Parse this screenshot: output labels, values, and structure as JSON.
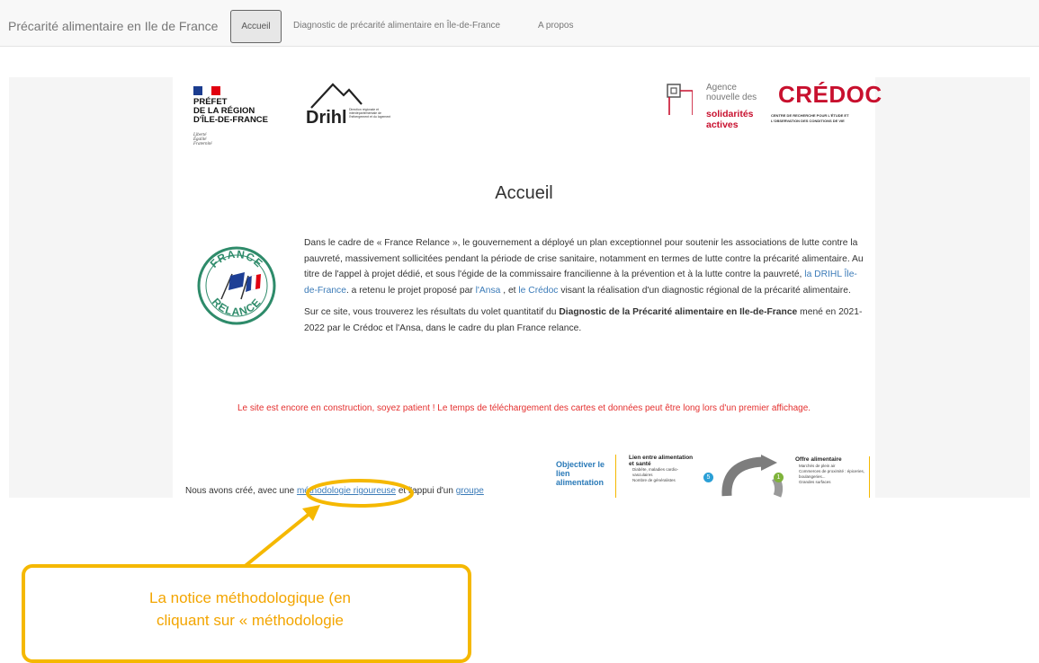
{
  "navbar": {
    "brand": "Précarité alimentaire en Ile de France",
    "items": [
      "Accueil",
      "Diagnostic de précarité alimentaire en Île-de-France",
      "A propos"
    ]
  },
  "logos": {
    "prefet": {
      "line1": "PRÉFET",
      "line2": "DE LA RÉGION",
      "line3": "D'ÎLE-DE-FRANCE",
      "devise1": "Liberté",
      "devise2": "Égalité",
      "devise3": "Fraternité"
    },
    "drihl": {
      "name": "Drihl",
      "sub": "Direction régionale et interdépartementale de l'hébergement et du logement"
    },
    "ansa": {
      "line1": "Agence",
      "line2": "nouvelle des",
      "line3": "solidarités",
      "line4": "actives"
    },
    "credoc": {
      "name": "CRÉDOC",
      "sub1": "CENTRE DE RECHERCHE POUR L'ÉTUDE ET",
      "sub2": "L'OBSERVATION DES CONDITIONS DE VIE"
    },
    "france_relance": {
      "top": "FRANCE",
      "bottom": "RELANCE"
    }
  },
  "main": {
    "title": "Accueil",
    "p1_a": "Dans le cadre de « France Relance », le gouvernement a déployé un plan exceptionnel pour soutenir les associations de lutte contre la pauvreté, massivement sollicitées pendant la période de crise sanitaire, notamment en termes de lutte contre la précarité alimentaire. Au titre de l'appel à projet dédié, et sous l'égide de la commissaire francilienne à la prévention et à la lutte contre la pauvreté, ",
    "p1_link1": "la DRIHL Île-de-France",
    "p1_b": ". a retenu le projet proposé par ",
    "p1_link2": "l'Ansa",
    "p1_c": " , et ",
    "p1_link3": "le Crédoc",
    "p1_d": " visant la réalisation d'un diagnostic régional de la précarité alimentaire.",
    "p2_a": "Sur ce site, vous trouverez les résultats du volet quantitatif du ",
    "p2_bold": "Diagnostic de la Précarité alimentaire en Ile-de-France",
    "p2_b": " mené en 2021-2022 par le Crédoc et l'Ansa, dans le cadre du plan France relance.",
    "warning": "Le site est encore en construction, soyez patient ! Le temps de téléchargement des cartes et données peut être long lors d'un premier affichage.",
    "bottom_a": "Nous avons créé, avec une ",
    "bottom_link1": "méthodologie rigoureuse",
    "bottom_b": " et l'appui d'un ",
    "bottom_link2": "groupe"
  },
  "diagram": {
    "left_label": "Objectiver le lien alimentation",
    "col1_title": "Lien entre alimentation et santé",
    "col1_item1": "Diabète, maladies cardio-vasculaires",
    "col1_item2": "Nombre de généralistes",
    "col2_title": "Offre alimentaire",
    "col2_item1": "Marchés de plein air",
    "col2_item2": "Commerces de proximité : épiceries, boulangeries...",
    "col2_item3": "Grandes surfaces",
    "badge_left": "5",
    "badge_right": "1"
  },
  "callout": {
    "line1": "La notice méthodologique (en",
    "line2": "cliquant sur « méthodologie"
  },
  "colors": {
    "highlight": "#f5b800",
    "link": "#3b7bb8",
    "warning": "#e4302f",
    "brand_red": "#c8102e"
  }
}
